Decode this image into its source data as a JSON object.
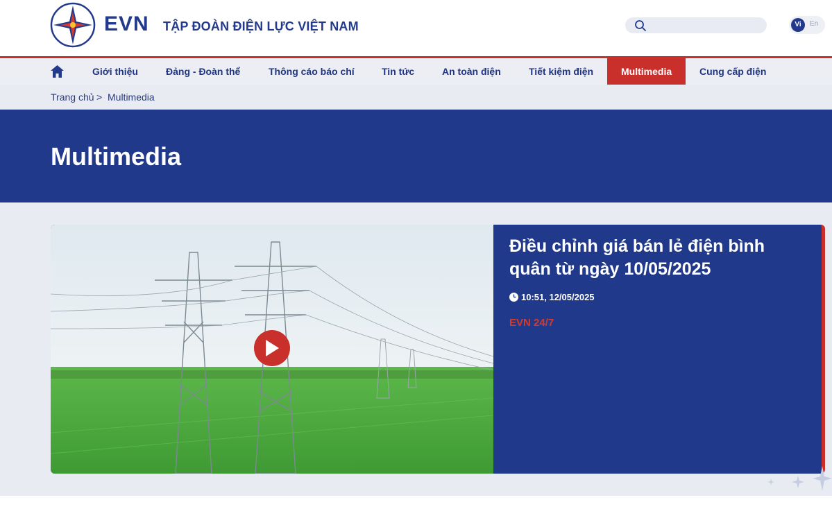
{
  "header": {
    "brand": "EVN",
    "corp_name": "TẬP ĐOÀN ĐIỆN LỰC VIỆT NAM",
    "search_placeholder": "",
    "lang_vi": "Vi",
    "lang_en": "En"
  },
  "nav": {
    "items": [
      {
        "label": "Giới thiệu"
      },
      {
        "label": "Đảng - Đoàn thể"
      },
      {
        "label": "Thông cáo báo chí"
      },
      {
        "label": "Tin tức"
      },
      {
        "label": "An toàn điện"
      },
      {
        "label": "Tiết kiệm điện"
      },
      {
        "label": "Multimedia",
        "active": true
      },
      {
        "label": "Cung cấp điện"
      }
    ]
  },
  "breadcrumb": {
    "home": "Trang chủ",
    "separator": ">",
    "current": "Multimedia"
  },
  "page_title": "Multimedia",
  "featured": {
    "title": "Điều chỉnh giá bán lẻ điện bình quân từ ngày 10/05/2025",
    "timestamp": "10:51, 12/05/2025",
    "category": "EVN 24/7"
  },
  "colors": {
    "brand_blue": "#21398b",
    "accent_red": "#c9302c",
    "category_red": "#d63a2c",
    "light_bg": "#e8ebf2"
  },
  "icons": [
    "search-icon",
    "home-icon",
    "play-icon",
    "clock-icon",
    "evn-logo"
  ]
}
